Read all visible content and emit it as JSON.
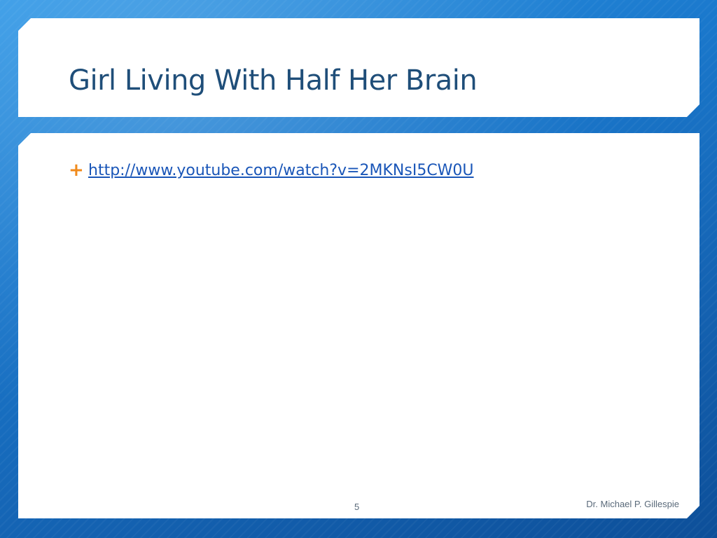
{
  "slide": {
    "title": "Girl Living With Half Her Brain",
    "bullets": [
      {
        "text": "http://www.youtube.com/watch?v=2MKNsI5CW0U",
        "icon": "plus-bullet-icon"
      }
    ],
    "slide_number": "5",
    "author": "Dr. Michael P. Gillespie"
  },
  "colors": {
    "title": "#1f4e79",
    "link": "#1a56b8",
    "bullet": "#f08a1c",
    "background": "#1a78cc"
  }
}
